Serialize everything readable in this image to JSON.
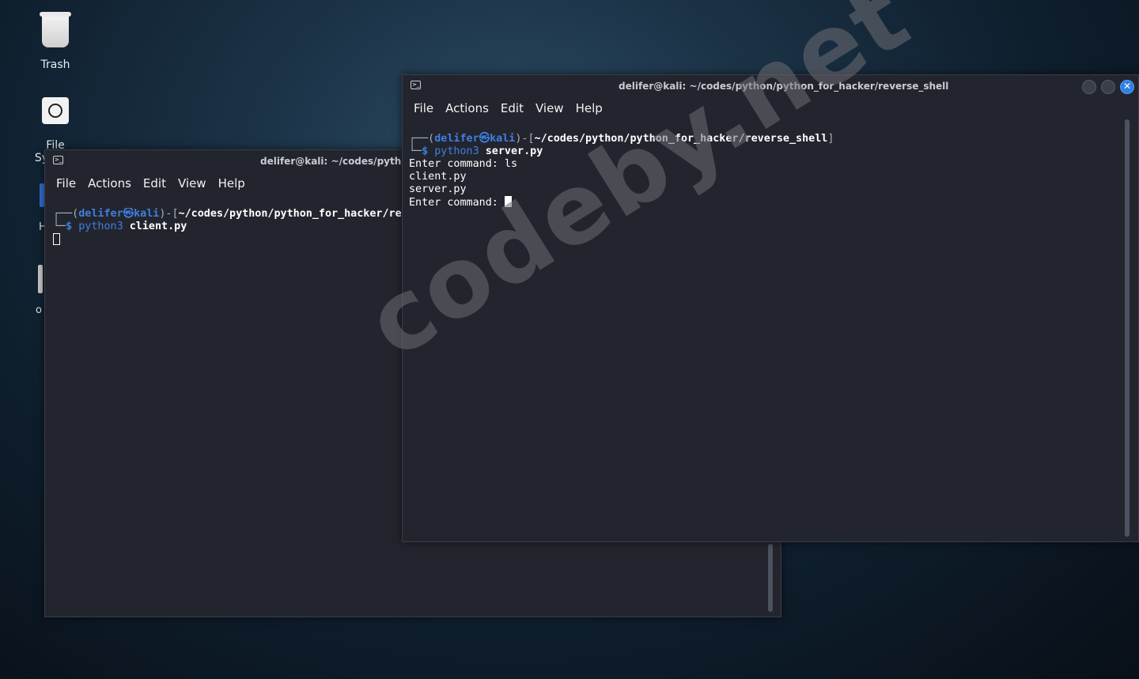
{
  "desktop": {
    "trash_label": "Trash",
    "filesystem_label": "File System",
    "partial_label_1": "H",
    "partial_label_2": "o"
  },
  "terminals": {
    "back": {
      "title": "delifer@kali: ~/codes/python/python_for_hacker/reverse_shell",
      "menu": [
        "File",
        "Actions",
        "Edit",
        "View",
        "Help"
      ],
      "prompt": {
        "user": "delifer",
        "symbol": "㉿",
        "host": "kali",
        "path": "~/codes/python/python_for_hacker/reverse_shell",
        "dollar": "$",
        "cmd": "python3",
        "arg": "client.py"
      }
    },
    "front": {
      "title": "delifer@kali: ~/codes/python/python_for_hacker/reverse_shell",
      "menu": [
        "File",
        "Actions",
        "Edit",
        "View",
        "Help"
      ],
      "prompt": {
        "user": "delifer",
        "symbol": "㉿",
        "host": "kali",
        "path": "~/codes/python/python_for_hacker/reverse_shell",
        "dollar": "$",
        "cmd": "python3",
        "arg": "server.py"
      },
      "output": [
        "Enter command: ls",
        "client.py",
        "server.py"
      ],
      "last_prompt": "Enter command: "
    }
  },
  "watermark": "codeby.net"
}
